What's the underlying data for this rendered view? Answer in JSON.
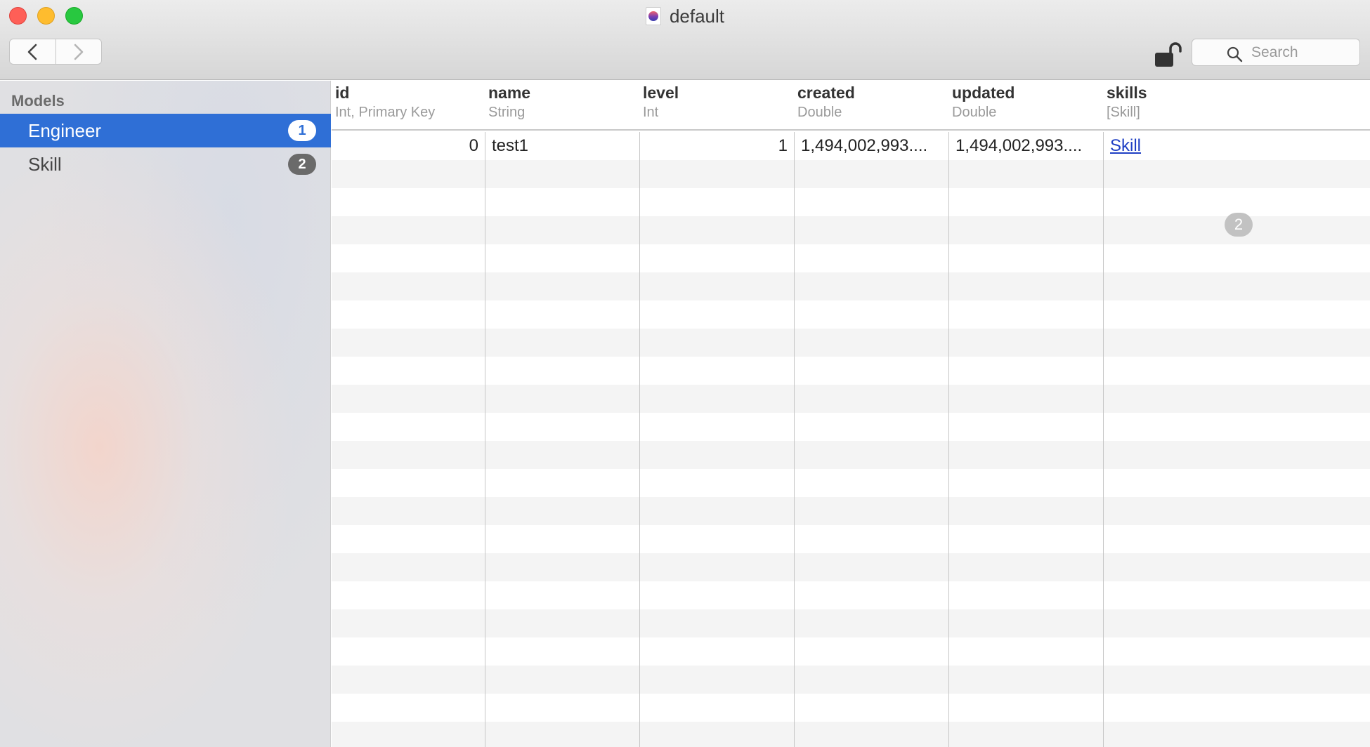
{
  "window": {
    "title": "default"
  },
  "toolbar": {
    "back_icon": "chevron-left-icon",
    "forward_icon": "chevron-right-icon",
    "lock_icon": "unlocked-padlock-icon",
    "search_placeholder": "Search"
  },
  "sidebar": {
    "heading": "Models",
    "items": [
      {
        "label": "Engineer",
        "count": "1",
        "selected": true
      },
      {
        "label": "Skill",
        "count": "2",
        "selected": false
      }
    ]
  },
  "table": {
    "columns": [
      {
        "name": "id",
        "type": "Int, Primary Key"
      },
      {
        "name": "name",
        "type": "String"
      },
      {
        "name": "level",
        "type": "Int"
      },
      {
        "name": "created",
        "type": "Double"
      },
      {
        "name": "updated",
        "type": "Double"
      },
      {
        "name": "skills",
        "type": "[Skill]"
      }
    ],
    "rows": [
      {
        "id": "0",
        "name": "test1",
        "level": "1",
        "created": "1,494,002,993....",
        "updated": "1,494,002,993....",
        "skills_link": "Skill",
        "skills_count": "2"
      }
    ]
  },
  "colors": {
    "selection": "#2f6fd6",
    "link": "#1f3fc4"
  }
}
